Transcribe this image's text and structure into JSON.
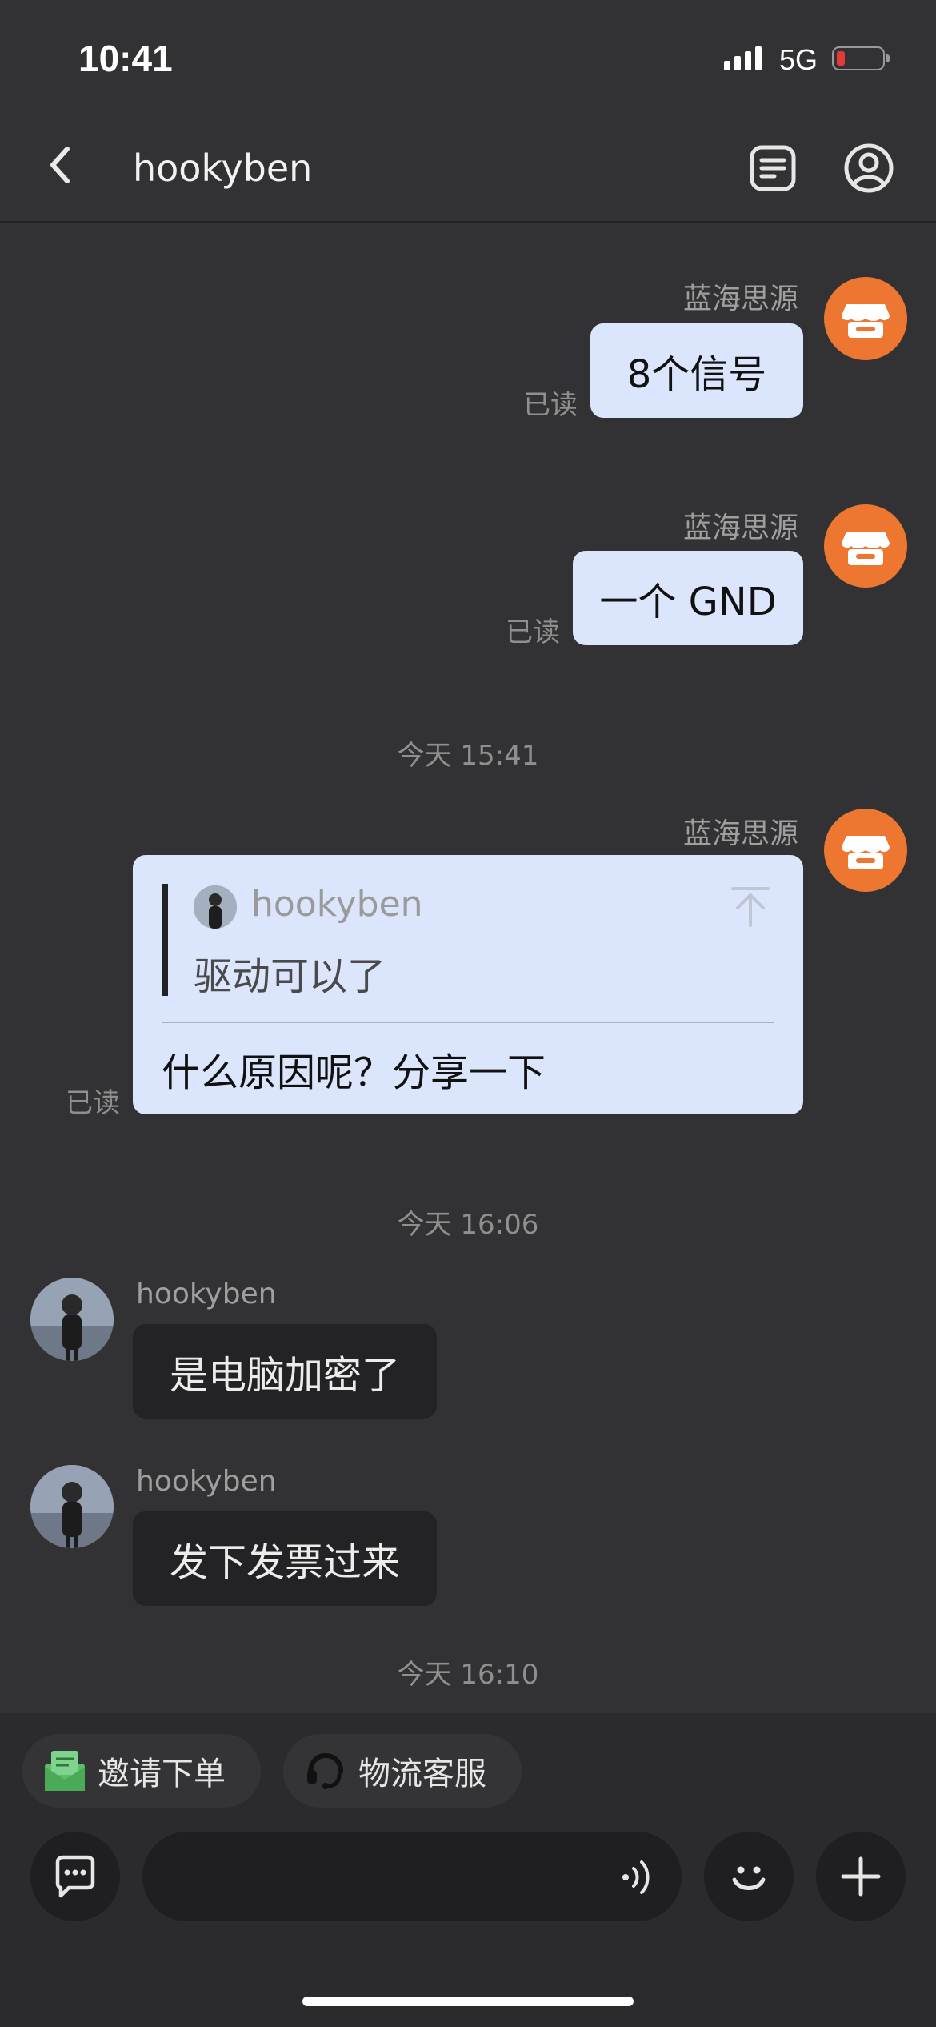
{
  "status_bar": {
    "time": "10:41",
    "network": "5G"
  },
  "header": {
    "title": "hookyben"
  },
  "messages": {
    "m1": {
      "sender": "蓝海思源",
      "text": "8个信号",
      "read": "已读"
    },
    "m2": {
      "sender": "蓝海思源",
      "text": "一个 GND",
      "read": "已读"
    },
    "ts1": "今天 15:41",
    "m3": {
      "sender": "蓝海思源",
      "quote_name": "hookyben",
      "quote_text": "驱动可以了",
      "text": "什么原因呢？分享一下",
      "read": "已读"
    },
    "ts2": "今天 16:06",
    "m4": {
      "sender": "hookyben",
      "text": "是电脑加密了"
    },
    "m5": {
      "sender": "hookyben",
      "text": "发下发票过来"
    },
    "ts3": "今天 16:10"
  },
  "quick_actions": {
    "invite_order": "邀请下单",
    "logistics_service": "物流客服"
  },
  "icons": {
    "back": "chevron-left-icon",
    "orders": "document-list-icon",
    "profile": "user-circle-icon",
    "shop_avatar": "store-icon",
    "chat": "chat-bubble-icon",
    "voice": "voice-wave-icon",
    "emoji": "smile-icon",
    "plus": "plus-icon"
  },
  "colors": {
    "background": "#323234",
    "outgoing_bubble": "#dbe5fb",
    "incoming_bubble": "#232325",
    "shop_avatar": "#ed7631",
    "battery_low": "#e23a3a"
  }
}
